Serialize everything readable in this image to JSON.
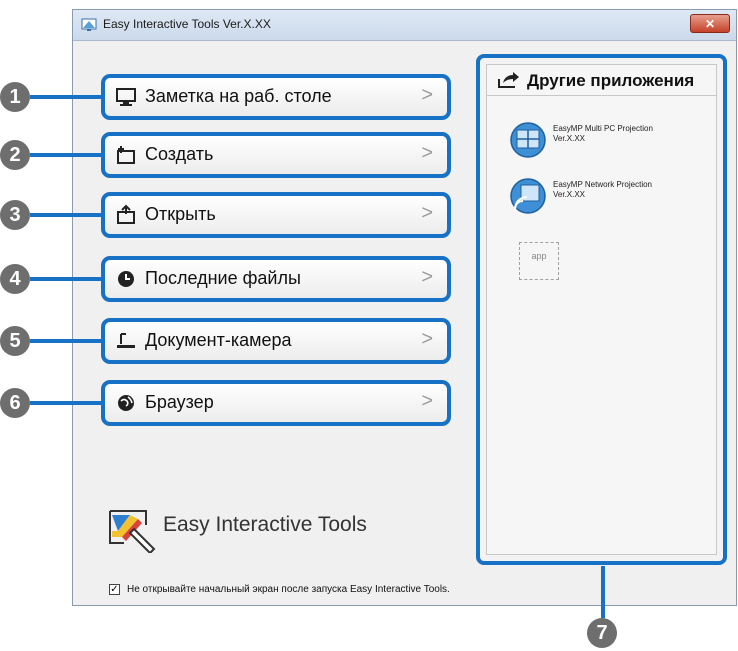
{
  "window": {
    "title": "Easy Interactive Tools Ver.X.XX",
    "close_label": "✕"
  },
  "menu": {
    "items": [
      {
        "number": "1",
        "label": "Заметка на раб. столе",
        "icon": "monitor-icon"
      },
      {
        "number": "2",
        "label": "Создать",
        "icon": "new-page-icon"
      },
      {
        "number": "3",
        "label": "Открыть",
        "icon": "open-folder-icon"
      },
      {
        "number": "4",
        "label": "Последние файлы",
        "icon": "clock-icon"
      },
      {
        "number": "5",
        "label": "Документ-камера",
        "icon": "document-camera-icon"
      },
      {
        "number": "6",
        "label": "Браузер",
        "icon": "globe-icon"
      }
    ],
    "chevron": ">"
  },
  "other_apps": {
    "title": "Другие приложения",
    "number": "7",
    "apps": [
      {
        "name": "EasyMP Multi PC Projection",
        "version": "Ver.X.XX"
      },
      {
        "name": "EasyMP Network Projection",
        "version": "Ver.X.XX"
      }
    ],
    "placeholder": "app"
  },
  "logo": {
    "text": "Easy Interactive Tools"
  },
  "startup": {
    "label": "Не открывайте начальный экран после запуска Easy Interactive Tools.",
    "checked": true,
    "mark": "✓"
  }
}
